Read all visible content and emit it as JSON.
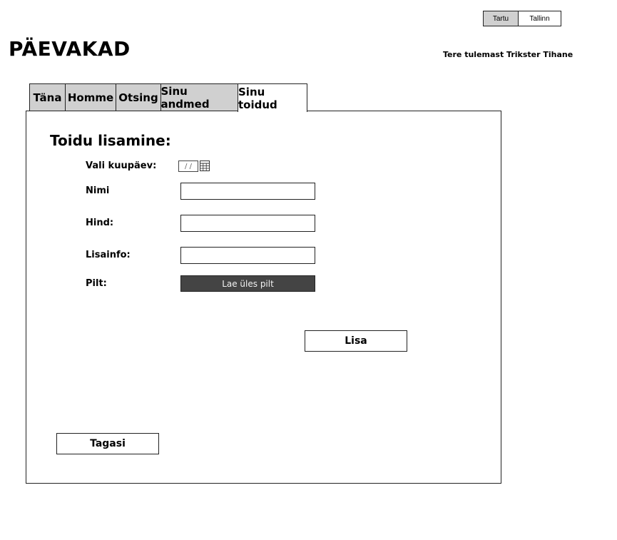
{
  "header": {
    "cities": [
      "Tartu",
      "Tallinn"
    ],
    "active_city": "Tartu",
    "title": "PÄEVAKAD",
    "welcome": "Tere tulemast Trikster Tihane"
  },
  "tabs": [
    {
      "label": "Täna",
      "active": false
    },
    {
      "label": "Homme",
      "active": false
    },
    {
      "label": "Otsing",
      "active": false
    },
    {
      "label": "Sinu andmed",
      "active": false
    },
    {
      "label": "Sinu toidud",
      "active": true
    }
  ],
  "form": {
    "title": "Toidu lisamine:",
    "date_label": "Vali kuupäev:",
    "date_placeholder": "/ /",
    "name_label": "Nimi",
    "name_value": "",
    "price_label": "Hind:",
    "price_value": "",
    "info_label": "Lisainfo:",
    "info_value": "",
    "image_label": "Pilt:",
    "upload_label": "Lae üles pilt",
    "add_label": "Lisa",
    "back_label": "Tagasi"
  },
  "icons": {
    "date_picker": "calendar-icon"
  },
  "colors": {
    "inactive_tab": "#d0d0d0",
    "upload_button_bg": "#444444",
    "upload_button_text": "#f2f2f2",
    "border": "#222222"
  }
}
